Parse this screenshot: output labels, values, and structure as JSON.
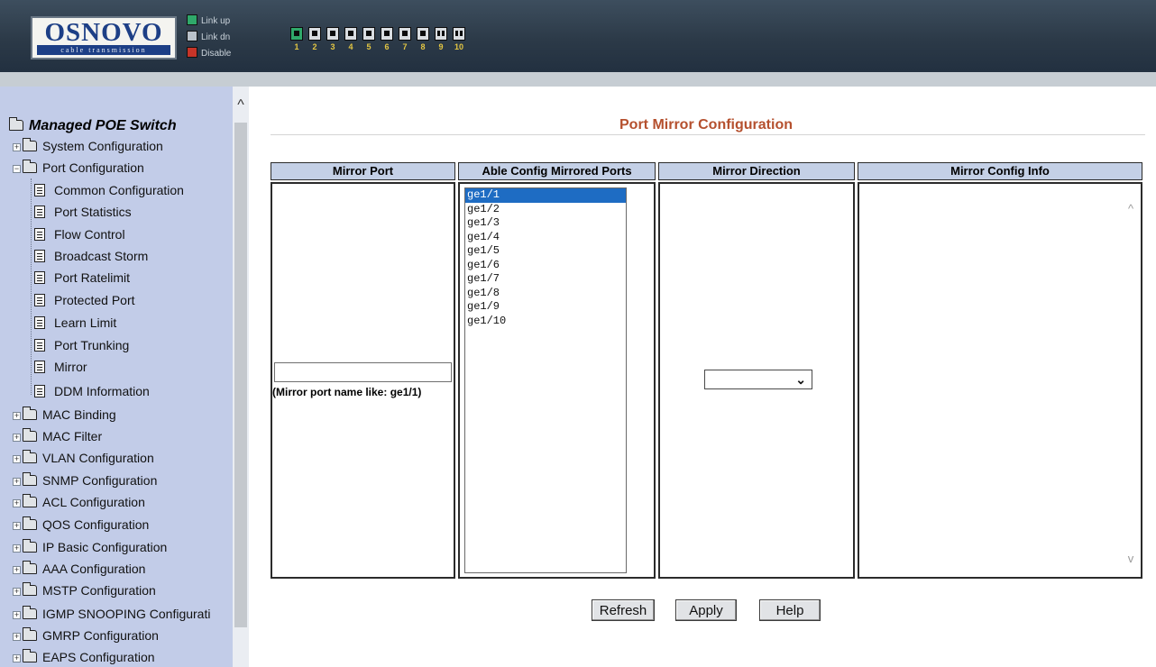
{
  "header": {
    "logo_text": "OSNOVO",
    "logo_subtitle": "cable transmission",
    "legend": [
      {
        "label": "Link up",
        "icon": "link-up-icon",
        "color": "#2fa86a"
      },
      {
        "label": "Link dn",
        "icon": "link-down-icon",
        "color": "#b9c1c9"
      },
      {
        "label": "Disable",
        "icon": "disable-icon",
        "color": "#c63428"
      }
    ],
    "ports": [
      {
        "number": "1",
        "status": "up"
      },
      {
        "number": "2",
        "status": "down"
      },
      {
        "number": "3",
        "status": "down"
      },
      {
        "number": "4",
        "status": "down"
      },
      {
        "number": "5",
        "status": "down"
      },
      {
        "number": "6",
        "status": "down"
      },
      {
        "number": "7",
        "status": "down"
      },
      {
        "number": "8",
        "status": "down"
      },
      {
        "number": "9",
        "status": "fiber"
      },
      {
        "number": "10",
        "status": "fiber"
      }
    ]
  },
  "sidebar": {
    "root": "Managed POE Switch",
    "items": [
      {
        "label": "System Configuration",
        "type": "folder"
      },
      {
        "label": "Port Configuration",
        "type": "folder-open"
      },
      {
        "label": "Common Configuration",
        "type": "page"
      },
      {
        "label": "Port Statistics",
        "type": "page"
      },
      {
        "label": "Flow Control",
        "type": "page"
      },
      {
        "label": "Broadcast Storm",
        "type": "page"
      },
      {
        "label": "Port Ratelimit",
        "type": "page"
      },
      {
        "label": "Protected Port",
        "type": "page"
      },
      {
        "label": "Learn Limit",
        "type": "page"
      },
      {
        "label": "Port Trunking",
        "type": "page"
      },
      {
        "label": "Mirror",
        "type": "page"
      },
      {
        "label": "DDM Information",
        "type": "page"
      },
      {
        "label": "MAC Binding",
        "type": "folder"
      },
      {
        "label": "MAC Filter",
        "type": "folder"
      },
      {
        "label": "VLAN Configuration",
        "type": "folder"
      },
      {
        "label": "SNMP Configuration",
        "type": "folder"
      },
      {
        "label": "ACL Configuration",
        "type": "folder"
      },
      {
        "label": "QOS Configuration",
        "type": "folder"
      },
      {
        "label": "IP Basic Configuration",
        "type": "folder"
      },
      {
        "label": "AAA Configuration",
        "type": "folder"
      },
      {
        "label": "MSTP Configuration",
        "type": "folder"
      },
      {
        "label": "IGMP SNOOPING Configurati",
        "type": "folder"
      },
      {
        "label": "GMRP Configuration",
        "type": "folder"
      },
      {
        "label": "EAPS Configuration",
        "type": "folder"
      }
    ]
  },
  "main": {
    "title": "Port Mirror Configuration",
    "columns": {
      "mirror_port": "Mirror Port",
      "mirrored_ports": "Able Config Mirrored Ports",
      "direction": "Mirror Direction",
      "info": "Mirror Config Info"
    },
    "mirror_port_value": "",
    "mirror_port_hint": "(Mirror port name like: ge1/1)",
    "mirrored_port_options": [
      "ge1/1",
      "ge1/2",
      "ge1/3",
      "ge1/4",
      "ge1/5",
      "ge1/6",
      "ge1/7",
      "ge1/8",
      "ge1/9",
      "ge1/10"
    ],
    "mirrored_port_selected": "ge1/1",
    "direction_value": "",
    "buttons": {
      "refresh": "Refresh",
      "apply": "Apply",
      "help": "Help"
    }
  }
}
